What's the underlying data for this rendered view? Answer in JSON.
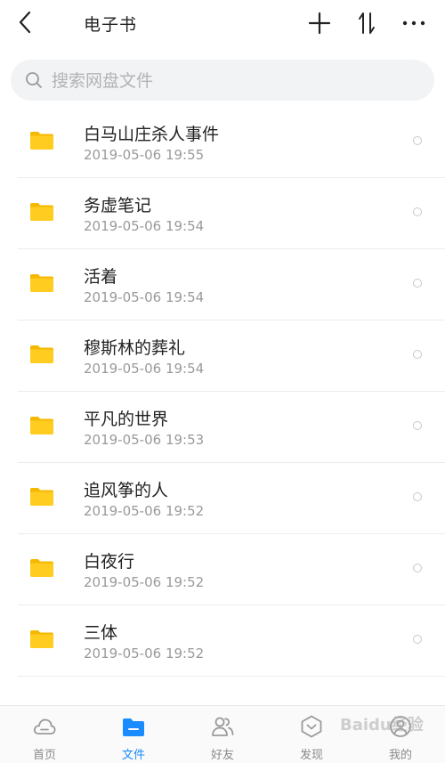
{
  "header": {
    "title": "电子书",
    "back_icon": "back-icon",
    "add_icon": "plus-icon",
    "sort_icon": "sort-icon",
    "more_icon": "more-icon"
  },
  "search": {
    "placeholder": "搜索网盘文件"
  },
  "files": [
    {
      "name": "白马山庄杀人事件",
      "date": "2019-05-06 19:55"
    },
    {
      "name": "务虚笔记",
      "date": "2019-05-06 19:54"
    },
    {
      "name": "活着",
      "date": "2019-05-06 19:54"
    },
    {
      "name": "穆斯林的葬礼",
      "date": "2019-05-06 19:54"
    },
    {
      "name": "平凡的世界",
      "date": "2019-05-06 19:53"
    },
    {
      "name": "追风筝的人",
      "date": "2019-05-06 19:52"
    },
    {
      "name": "白夜行",
      "date": "2019-05-06 19:52"
    },
    {
      "name": "三体",
      "date": "2019-05-06 19:52"
    }
  ],
  "tabs": [
    {
      "label": "首页",
      "icon": "cloud-icon",
      "active": false
    },
    {
      "label": "文件",
      "icon": "folder-icon",
      "active": true
    },
    {
      "label": "好友",
      "icon": "friends-icon",
      "active": false
    },
    {
      "label": "发现",
      "icon": "discover-icon",
      "active": false
    },
    {
      "label": "我的",
      "icon": "profile-icon",
      "active": false
    }
  ],
  "watermark": "Baidu经验",
  "colors": {
    "accent": "#1a8cff",
    "folder": "#ffcc1f",
    "folder_tab": "#f5b800"
  }
}
